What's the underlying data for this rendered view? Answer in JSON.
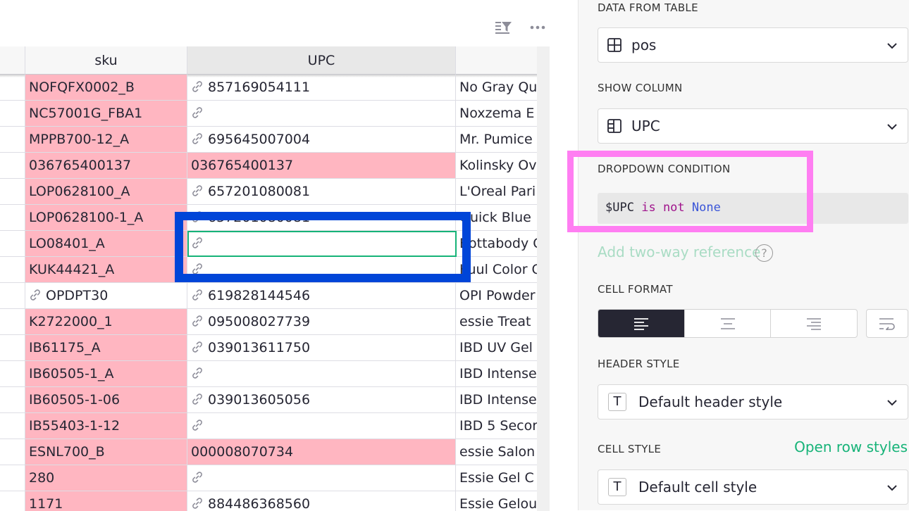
{
  "grid": {
    "columns": [
      {
        "label": "",
        "name": "col-prev"
      },
      {
        "label": "sku",
        "name": "col-sku"
      },
      {
        "label": "UPC",
        "name": "col-upc"
      },
      {
        "label": "",
        "name": "col-next"
      }
    ],
    "rows": [
      {
        "prev": "",
        "sku": "NOFQFX0002_B",
        "sku_link": false,
        "sku_pink": true,
        "upc": "857169054111",
        "upc_link": true,
        "upc_pink": false,
        "name": "No Gray Qu"
      },
      {
        "prev": "",
        "sku": "NC57001G_FBA1",
        "sku_link": false,
        "sku_pink": true,
        "upc": "",
        "upc_link": true,
        "upc_pink": false,
        "name": "Noxzema E"
      },
      {
        "prev": "",
        "sku": "MPPB700-12_A",
        "sku_link": false,
        "sku_pink": true,
        "upc": "695645007004",
        "upc_link": true,
        "upc_pink": false,
        "name": "Mr. Pumice"
      },
      {
        "prev": "",
        "sku": "036765400137",
        "sku_link": false,
        "sku_pink": true,
        "upc": "036765400137",
        "upc_link": false,
        "upc_pink": true,
        "name": "Kolinsky Ov"
      },
      {
        "prev": "",
        "sku": "LOP0628100_A",
        "sku_link": false,
        "sku_pink": true,
        "upc": "657201080081",
        "upc_link": true,
        "upc_pink": false,
        "name": "L'Oreal Pari"
      },
      {
        "prev": "",
        "sku": "LOP0628100-1_A",
        "sku_link": false,
        "sku_pink": true,
        "upc": "657201080081",
        "upc_link": true,
        "upc_pink": false,
        "name": "Quick Blue"
      },
      {
        "prev": "",
        "sku": "LO08401_A",
        "sku_link": false,
        "sku_pink": true,
        "upc": "",
        "upc_link": true,
        "upc_pink": false,
        "name": "Bottabody C"
      },
      {
        "prev": "",
        "sku": "KUK44421_A",
        "sku_link": false,
        "sku_pink": true,
        "upc": "",
        "upc_link": true,
        "upc_pink": false,
        "name": "Kuul Color C"
      },
      {
        "prev": "",
        "sku": "OPDPT30",
        "sku_link": true,
        "sku_pink": false,
        "upc": "619828144546",
        "upc_link": true,
        "upc_pink": false,
        "name": "OPI Powder"
      },
      {
        "prev": "",
        "sku": "K2722000_1",
        "sku_link": false,
        "sku_pink": true,
        "upc": "095008027739",
        "upc_link": true,
        "upc_pink": false,
        "name": "essie Treat"
      },
      {
        "prev": "",
        "sku": "IB61175_A",
        "sku_link": false,
        "sku_pink": true,
        "upc": "039013611750",
        "upc_link": true,
        "upc_pink": false,
        "name": "IBD UV Gel"
      },
      {
        "prev": "",
        "sku": "IB60505-1_A",
        "sku_link": false,
        "sku_pink": true,
        "upc": "",
        "upc_link": true,
        "upc_pink": false,
        "name": "IBD Intense"
      },
      {
        "prev": "",
        "sku": "IB60505-1-06",
        "sku_link": false,
        "sku_pink": true,
        "upc": "039013605056",
        "upc_link": true,
        "upc_pink": false,
        "name": "IBD Intense"
      },
      {
        "prev": "",
        "sku": "IB55403-1-12",
        "sku_link": false,
        "sku_pink": true,
        "upc": "",
        "upc_link": true,
        "upc_pink": false,
        "name": "IBD 5 Secor"
      },
      {
        "prev": "",
        "sku": "ESNL700_B",
        "sku_link": false,
        "sku_pink": true,
        "upc": "000008070734",
        "upc_link": false,
        "upc_pink": true,
        "name": "essie Salon"
      },
      {
        "prev": "",
        "sku": "280",
        "sku_link": false,
        "sku_pink": true,
        "upc": "",
        "upc_link": true,
        "upc_pink": false,
        "name": "Essie Gel C"
      },
      {
        "prev": "",
        "sku": "1171",
        "sku_link": false,
        "sku_pink": true,
        "upc": "884486368560",
        "upc_link": true,
        "upc_pink": false,
        "name": "Essie Gelou"
      }
    ]
  },
  "panel": {
    "data_from_table_label": "DATA FROM TABLE",
    "data_from_table_value": "pos",
    "show_column_label": "SHOW COLUMN",
    "show_column_value": "UPC",
    "dropdown_condition_label": "DROPDOWN CONDITION",
    "condition": {
      "var": "$UPC",
      "kw1": "is",
      "kw2": "not",
      "const": "None"
    },
    "two_way_ref": "Add two-way reference",
    "help_glyph": "?",
    "cell_format_label": "CELL FORMAT",
    "header_style_label": "HEADER STYLE",
    "header_style_icon": "T",
    "header_style_value": "Default header style",
    "cell_style_label": "CELL STYLE",
    "open_row_styles": "Open row styles",
    "cell_style_icon": "T",
    "cell_style_value": "Default cell style"
  },
  "icons": {
    "sort_filter": "sort-filter-icon",
    "more": "more-icon",
    "link": "link-icon",
    "table": "table-icon",
    "column": "column-icon",
    "chevron": "chevron-down-icon"
  },
  "colors": {
    "pink_cell": "#ffb6c1",
    "cursor": "#16b378",
    "annotation_blue": "#0045d8",
    "annotation_magenta": "#ff7ef2",
    "accent_green": "#16b378",
    "keyword": "#a0148c",
    "constant": "#3b56d8"
  }
}
